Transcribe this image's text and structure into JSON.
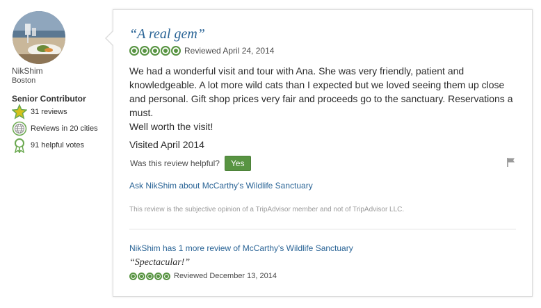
{
  "member": {
    "name": "NikShim",
    "location": "Boston",
    "level": "Senior Contributor",
    "badges": [
      {
        "icon": "star-badge-icon",
        "text": "31 reviews"
      },
      {
        "icon": "globe-icon",
        "text": "Reviews in 20 cities"
      },
      {
        "icon": "ribbon-icon",
        "text": "91 helpful votes"
      }
    ]
  },
  "review": {
    "title": "“A real gem”",
    "rating": 5,
    "date_text": "Reviewed April 24, 2014",
    "body_lines": [
      "We had a wonderful visit and tour with Ana. She was very friendly, patient and knowledgeable. A lot more wild cats than I expected but we loved seeing them up close and personal. Gift shop prices very fair and proceeds go to the sanctuary. Reservations a must.",
      "Well worth the visit!"
    ],
    "visited": "Visited April 2014",
    "helpful_question": "Was this review helpful?",
    "yes_label": "Yes",
    "ask_link": "Ask NikShim about McCarthy's Wildlife Sanctuary",
    "disclaimer": "This review is the subjective opinion of a TripAdvisor member and not of TripAdvisor LLC."
  },
  "more_reviews": {
    "link": "NikShim has 1 more review of McCarthy's Wildlife Sanctuary",
    "title": "“Spectacular!”",
    "rating": 5,
    "date_text": "Reviewed December 13, 2014"
  },
  "colors": {
    "link": "#2a6496",
    "rating_green": "#589442",
    "badge_green": "#6aa84f",
    "star_yellow": "#d4c21a"
  }
}
